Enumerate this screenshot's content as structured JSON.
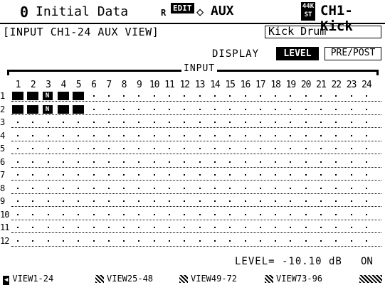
{
  "header": {
    "scene_number": "0",
    "scene_title": "Initial Data",
    "r_label": "R",
    "edit_badge": "EDIT",
    "diamond": "◇",
    "mode": "AUX",
    "fs_badge_top": "44K",
    "fs_badge_bottom": "ST",
    "channel": "CH1-Kick"
  },
  "view_title": "INPUT CH1-24 AUX VIEW",
  "channel_name": "Kick Drum",
  "display": {
    "label": "DISPLAY",
    "level_button": "LEVEL",
    "prepost_button": "PRE/POST"
  },
  "grid": {
    "title": "INPUT",
    "columns": [
      "1",
      "2",
      "3",
      "4",
      "5",
      "6",
      "7",
      "8",
      "9",
      "10",
      "11",
      "12",
      "13",
      "14",
      "15",
      "16",
      "17",
      "18",
      "19",
      "20",
      "21",
      "22",
      "23",
      "24"
    ],
    "rows": [
      "1",
      "2",
      "3",
      "4",
      "5",
      "6",
      "7",
      "8",
      "9",
      "10",
      "11",
      "12"
    ],
    "cells": [
      [
        "full",
        "full",
        "n",
        "full",
        "full",
        "dot",
        "dot",
        "dot",
        "dot",
        "dot",
        "dot",
        "dot",
        "dot",
        "dot",
        "dot",
        "dot",
        "dot",
        "dot",
        "dot",
        "dot",
        "dot",
        "dot",
        "dot",
        "dot"
      ],
      [
        "full",
        "full",
        "n",
        "full",
        "full",
        "dot",
        "dot",
        "dot",
        "dot",
        "dot",
        "dot",
        "dot",
        "dot",
        "dot",
        "dot",
        "dot",
        "dot",
        "dot",
        "dot",
        "dot",
        "dot",
        "dot",
        "dot",
        "dot"
      ],
      [
        "dot",
        "dot",
        "dot",
        "dot",
        "dot",
        "dot",
        "dot",
        "dot",
        "dot",
        "dot",
        "dot",
        "dot",
        "dot",
        "dot",
        "dot",
        "dot",
        "dot",
        "dot",
        "dot",
        "dot",
        "dot",
        "dot",
        "dot",
        "dot"
      ],
      [
        "dot",
        "dot",
        "dot",
        "dot",
        "dot",
        "dot",
        "dot",
        "dot",
        "dot",
        "dot",
        "dot",
        "dot",
        "dot",
        "dot",
        "dot",
        "dot",
        "dot",
        "dot",
        "dot",
        "dot",
        "dot",
        "dot",
        "dot",
        "dot"
      ],
      [
        "dot",
        "dot",
        "dot",
        "dot",
        "dot",
        "dot",
        "dot",
        "dot",
        "dot",
        "dot",
        "dot",
        "dot",
        "dot",
        "dot",
        "dot",
        "dot",
        "dot",
        "dot",
        "dot",
        "dot",
        "dot",
        "dot",
        "dot",
        "dot"
      ],
      [
        "dot",
        "dot",
        "dot",
        "dot",
        "dot",
        "dot",
        "dot",
        "dot",
        "dot",
        "dot",
        "dot",
        "dot",
        "dot",
        "dot",
        "dot",
        "dot",
        "dot",
        "dot",
        "dot",
        "dot",
        "dot",
        "dot",
        "dot",
        "dot"
      ],
      [
        "dot",
        "dot",
        "dot",
        "dot",
        "dot",
        "dot",
        "dot",
        "dot",
        "dot",
        "dot",
        "dot",
        "dot",
        "dot",
        "dot",
        "dot",
        "dot",
        "dot",
        "dot",
        "dot",
        "dot",
        "dot",
        "dot",
        "dot",
        "dot"
      ],
      [
        "dot",
        "dot",
        "dot",
        "dot",
        "dot",
        "dot",
        "dot",
        "dot",
        "dot",
        "dot",
        "dot",
        "dot",
        "dot",
        "dot",
        "dot",
        "dot",
        "dot",
        "dot",
        "dot",
        "dot",
        "dot",
        "dot",
        "dot",
        "dot"
      ],
      [
        "dot",
        "dot",
        "dot",
        "dot",
        "dot",
        "dot",
        "dot",
        "dot",
        "dot",
        "dot",
        "dot",
        "dot",
        "dot",
        "dot",
        "dot",
        "dot",
        "dot",
        "dot",
        "dot",
        "dot",
        "dot",
        "dot",
        "dot",
        "dot"
      ],
      [
        "dot",
        "dot",
        "dot",
        "dot",
        "dot",
        "dot",
        "dot",
        "dot",
        "dot",
        "dot",
        "dot",
        "dot",
        "dot",
        "dot",
        "dot",
        "dot",
        "dot",
        "dot",
        "dot",
        "dot",
        "dot",
        "dot",
        "dot",
        "dot"
      ],
      [
        "dot",
        "dot",
        "dot",
        "dot",
        "dot",
        "dot",
        "dot",
        "dot",
        "dot",
        "dot",
        "dot",
        "dot",
        "dot",
        "dot",
        "dot",
        "dot",
        "dot",
        "dot",
        "dot",
        "dot",
        "dot",
        "dot",
        "dot",
        "dot"
      ],
      [
        "dot",
        "dot",
        "dot",
        "dot",
        "dot",
        "dot",
        "dot",
        "dot",
        "dot",
        "dot",
        "dot",
        "dot",
        "dot",
        "dot",
        "dot",
        "dot",
        "dot",
        "dot",
        "dot",
        "dot",
        "dot",
        "dot",
        "dot",
        "dot"
      ]
    ],
    "n_marker": "N"
  },
  "readout": {
    "level": "LEVEL= -10.10 dB",
    "state": "ON"
  },
  "tabs": [
    {
      "label": "VIEW1-24",
      "icon": "left-arrow-icon"
    },
    {
      "label": "VIEW25-48"
    },
    {
      "label": "VIEW49-72"
    },
    {
      "label": "VIEW73-96"
    }
  ]
}
